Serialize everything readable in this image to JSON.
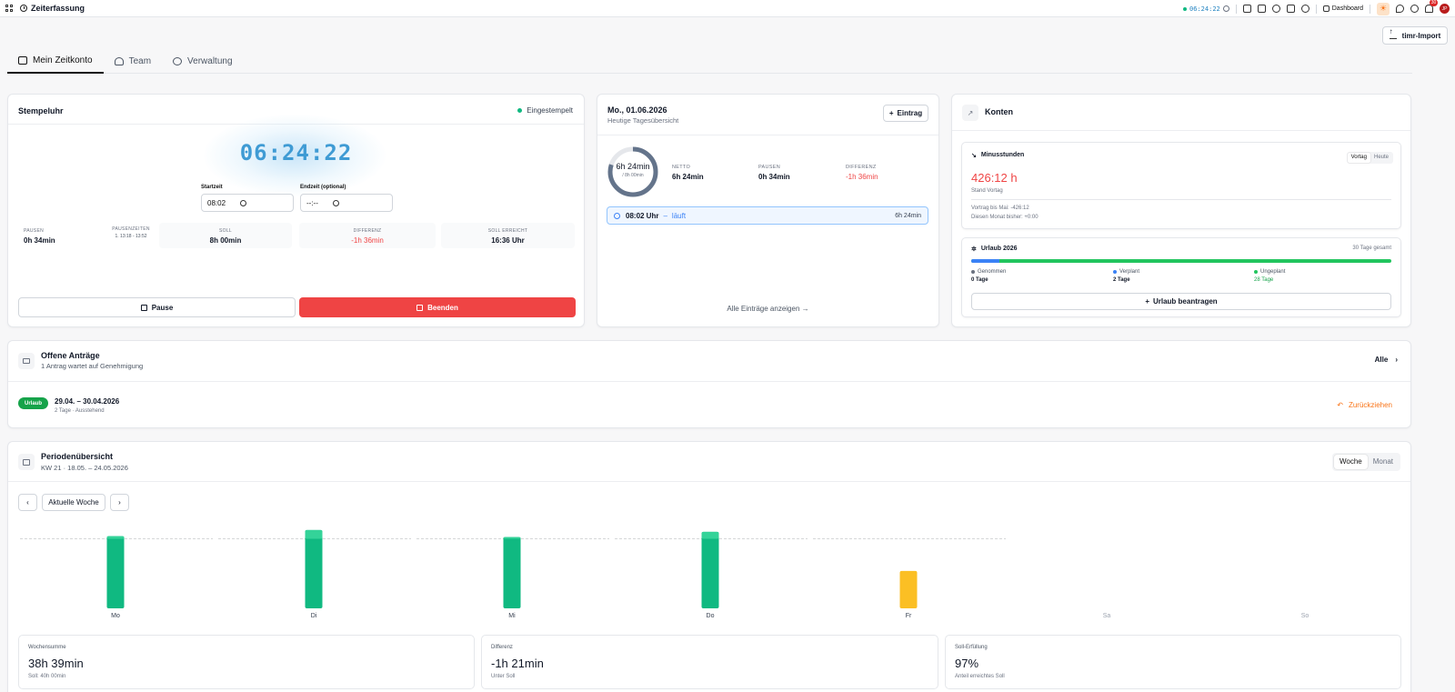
{
  "app": {
    "title": "Zeiterfassung"
  },
  "topbar": {
    "timer": "06:24:22",
    "dashboard_label": "Dashboard",
    "notification_count": "30",
    "avatar_initials": "JP"
  },
  "import_button": "timr-Import",
  "tabs": [
    {
      "label": "Mein Zeitkonto"
    },
    {
      "label": "Team"
    },
    {
      "label": "Verwaltung"
    }
  ],
  "stempeluhr": {
    "title": "Stempeluhr",
    "status": "Eingestempelt",
    "time": "06:24:22",
    "start_label": "Startzeit",
    "start_value": "08:02",
    "end_label": "Endzeit (optional)",
    "end_value": "--:--",
    "stats": {
      "pausen_label": "PAUSEN",
      "pausen_value": "0h 34min",
      "pausenzeiten_label": "PAUSENZEITEN",
      "pausenzeiten_value": "1. 13:18 - 13:52",
      "soll_label": "SOLL",
      "soll_value": "8h 00min",
      "differenz_label": "DIFFERENZ",
      "differenz_value": "-1h 36min",
      "erreicht_label": "SOLL ERREICHT",
      "erreicht_value": "16:36 Uhr"
    },
    "pause_button": "Pause",
    "end_button": "Beenden"
  },
  "tag": {
    "date": "Mo., 01.06.2026",
    "subtitle": "Heutige Tagesübersicht",
    "add_button": "Eintrag",
    "ring_main": "6h 24min",
    "ring_sub": "/ 8h 00min",
    "ring_progress": 0.8,
    "netto_label": "NETTO",
    "netto_value": "6h 24min",
    "pausen_label": "PAUSEN",
    "pausen_value": "0h 34min",
    "differenz_label": "DIFFERENZ",
    "differenz_value": "-1h 36min",
    "entry": {
      "start": "08:02 Uhr",
      "sep": "–",
      "status": "läuft",
      "duration": "6h 24min"
    },
    "all_link": "Alle Einträge anzeigen"
  },
  "konten": {
    "title": "Konten",
    "minus": {
      "title": "Minusstunden",
      "seg": [
        "Vortag",
        "Heute"
      ],
      "value": "426:12 h",
      "sub": "Stand Vortag",
      "info1": "Vortrag bis Mai: -426:12",
      "info2": "Diesen Monat bisher: +0:00"
    },
    "urlaub": {
      "title": "Urlaub 2026",
      "total": "30 Tage gesamt",
      "taken_fraction": 0.0,
      "planned_fraction": 0.067,
      "genommen_label": "Genommen",
      "genommen_value": "0 Tage",
      "verplant_label": "Verplant",
      "verplant_value": "2 Tage",
      "ungeplant_label": "Ungeplant",
      "ungeplant_value": "28 Tage",
      "button": "Urlaub beantragen"
    }
  },
  "antraege": {
    "title": "Offene Anträge",
    "subtitle": "1 Antrag wartet auf Genehmigung",
    "all_label": "Alle",
    "item": {
      "badge": "Urlaub",
      "dates": "29.04. – 30.04.2026",
      "meta": "2 Tage · Ausstehend",
      "action": "Zurückziehen"
    }
  },
  "perioden": {
    "title": "Periodenübersicht",
    "subtitle": "KW 21 · 18.05. – 24.05.2026",
    "seg": [
      "Woche",
      "Monat"
    ],
    "current_week": "Aktuelle Woche",
    "summary": [
      {
        "label": "Wochensumme",
        "value": "38h 39min",
        "sub": "Soll: 40h 00min"
      },
      {
        "label": "Differenz",
        "value": "-1h 21min",
        "sub": "Unter Soll"
      },
      {
        "label": "Soll-Erfüllung",
        "value": "97%",
        "sub": "Anteil erreichtes Soll"
      }
    ]
  },
  "chart_data": {
    "type": "bar",
    "categories": [
      "Mo",
      "Di",
      "Mi",
      "Do",
      "Fr",
      "Sa",
      "So"
    ],
    "values": [
      8.3,
      9.0,
      8.2,
      8.8,
      4.3,
      0,
      0
    ],
    "target": [
      8,
      8,
      8,
      8,
      8,
      0,
      0
    ],
    "colors": [
      "#10b981",
      "#10b981",
      "#10b981",
      "#10b981",
      "#fbbf24",
      "#10b981",
      "#10b981"
    ],
    "overtime_color": "#34d399",
    "ylim": [
      0,
      9.2
    ],
    "grid": false
  }
}
